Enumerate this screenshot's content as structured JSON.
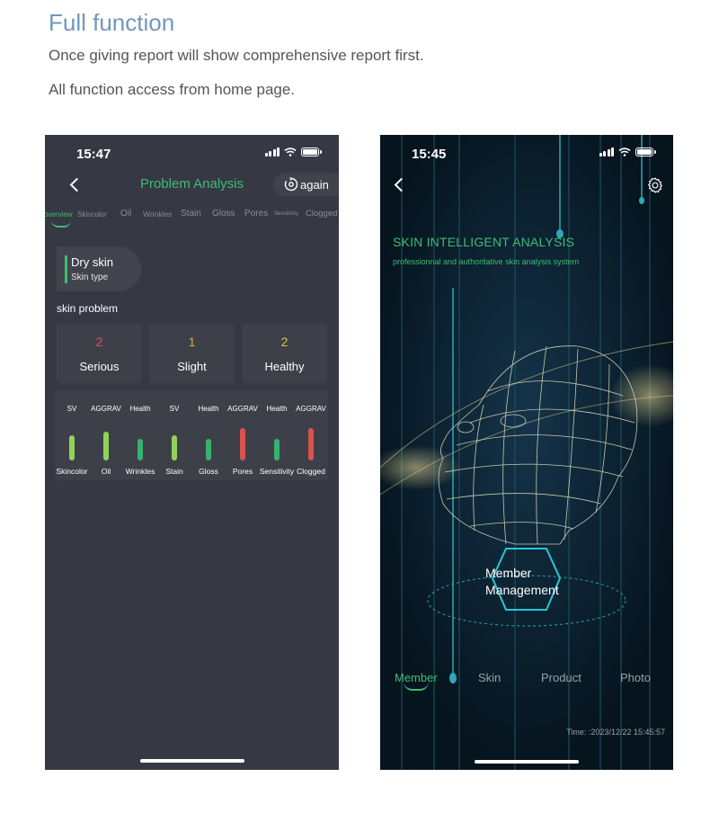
{
  "header": {
    "title": "Full function",
    "line1": "Once giving report will show comprehensive report first.",
    "line2": "All function access from home page."
  },
  "left_phone": {
    "status_time": "15:47",
    "nav_title": "Problem Analysis",
    "again_label": "again",
    "tabs": [
      {
        "label": "overview",
        "active": true
      },
      {
        "label": "Skincolor"
      },
      {
        "label": "Oil"
      },
      {
        "label": "Wrinkles"
      },
      {
        "label": "Stain"
      },
      {
        "label": "Gloss"
      },
      {
        "label": "Pores"
      },
      {
        "label": "Sensitivity"
      },
      {
        "label": "Clogged"
      }
    ],
    "skin_type": {
      "value": "Dry skin",
      "label": "Skin type"
    },
    "skin_problem_label": "skin problem",
    "counts": [
      {
        "value": "2",
        "label": "Serious",
        "color": "#d9534f"
      },
      {
        "value": "1",
        "label": "Slight",
        "color": "#e0a43a"
      },
      {
        "value": "2",
        "label": "Healthy",
        "color": "#e6c23a"
      }
    ],
    "bars": [
      {
        "name": "Skincolor",
        "status": "SV",
        "level": 0.7,
        "color": "#8fd359"
      },
      {
        "name": "Oil",
        "status": "AGGRAV",
        "level": 0.8,
        "color": "#8fd359"
      },
      {
        "name": "Wrinkles",
        "status": "Health",
        "level": 0.6,
        "color": "#34b36e"
      },
      {
        "name": "Stain",
        "status": "SV",
        "level": 0.7,
        "color": "#8fd359"
      },
      {
        "name": "Gloss",
        "status": "Health",
        "level": 0.6,
        "color": "#34b36e"
      },
      {
        "name": "Pores",
        "status": "AGGRAV",
        "level": 0.9,
        "color": "#d9534f"
      },
      {
        "name": "Sensitivity",
        "status": "Health",
        "level": 0.6,
        "color": "#34b36e"
      },
      {
        "name": "Clogged",
        "status": "AGGRAV",
        "level": 0.9,
        "color": "#d9534f"
      }
    ]
  },
  "right_phone": {
    "status_time": "15:45",
    "hero_title": "SKIN INTELLIGENT ANALYSIS",
    "hero_subtitle": "professionnal and authoritative skin analysis system",
    "center_button": {
      "line1": "Member",
      "line2": "Management"
    },
    "bottom_tabs": [
      {
        "label": "Member",
        "active": true
      },
      {
        "label": "Skin"
      },
      {
        "label": "Product"
      },
      {
        "label": "Photo"
      }
    ],
    "timestamp": "Time: :2023/12/22 15:45:57"
  },
  "colors": {
    "accent_green": "#3dbd73",
    "title_blue": "#6f97bd"
  }
}
